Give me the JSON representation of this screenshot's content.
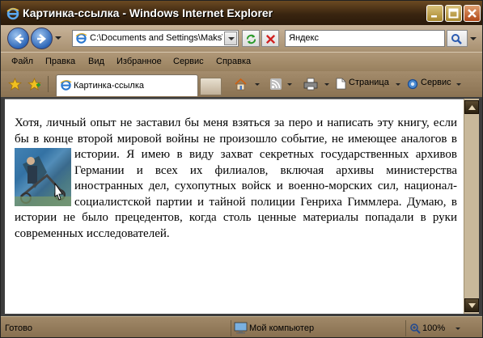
{
  "window": {
    "title": "Картинка-ссылка - Windows Internet Explorer"
  },
  "address": {
    "url": "C:\\Documents and Settings\\Maks\\"
  },
  "search": {
    "text": "Яндекс"
  },
  "menu": [
    "Файл",
    "Правка",
    "Вид",
    "Избранное",
    "Сервис",
    "Справка"
  ],
  "tab": {
    "label": "Картинка-ссылка"
  },
  "commands": {
    "page": "Страница",
    "tools": "Сервис"
  },
  "content": {
    "text_before": "Хотя, личный опыт не заставил бы меня взяться за перо и написать эту книгу, если бы в конце второй мировой войны не произошло событие, не имеющее аналогов в истории.  Я имею в виду захват секретных государственных архивов Германии и всех их филиалов, включая архивы министерства иностранных дел, сухопутных войск и военно-морских сил, национал-социалистской партии и тайной полиции Генриха Гиммлера. Думаю, в истории не было прецедентов, когда столь ценные материалы попадали в руки современных исследователей."
  },
  "status": {
    "text": "Готово",
    "zone": "Мой компьютер",
    "zoom": "100%"
  },
  "colors": {
    "title_bar": "#3a2510",
    "chrome": "#a89070"
  }
}
